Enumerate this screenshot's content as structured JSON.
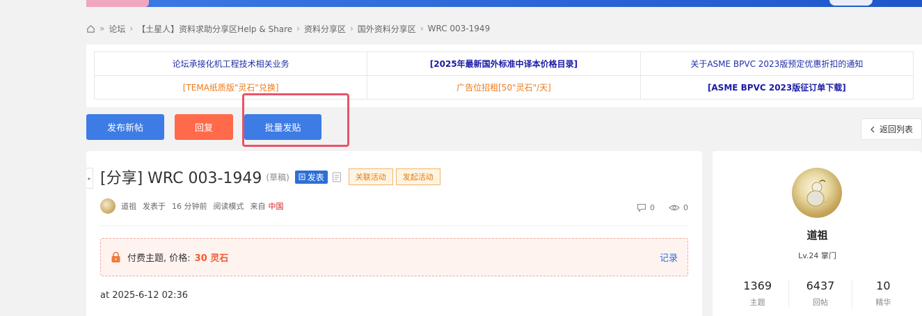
{
  "breadcrumb": {
    "items": [
      "论坛",
      "【土星人】资料求助分享区Help & Share",
      "资料分享区",
      "国外资料分享区",
      "WRC 003-1949"
    ]
  },
  "links": {
    "row1": [
      "论坛承接化机工程技术相关业务",
      "[2025年最新国外标准中译本价格目录]",
      "关于ASME BPVC 2023版预定优惠折扣的通知"
    ],
    "row2": [
      "[TEMA纸质版\"灵石\"兑换]",
      "广告位招租[50\"灵石\"/天]",
      "[ASME BPVC 2023版征订单下载]"
    ]
  },
  "actions": {
    "new_post": "发布新帖",
    "reply": "回复",
    "batch_post": "批量发贴",
    "back_to_list": "返回列表"
  },
  "thread": {
    "title": "[分享] WRC 003-1949",
    "draft_label": "(草稿)",
    "publish_label": "发表",
    "tag_related": "关联活动",
    "tag_launch": "发起活动",
    "author": "道祖",
    "posted_prefix": "发表于",
    "posted_time": "16 分钟前",
    "read_mode": "阅读模式",
    "from_prefix": "来自",
    "from_region": "中国",
    "reply_count": "0",
    "view_count": "0",
    "paid_label": "付费主题, 价格:",
    "price": "30 灵石",
    "record_label": "记录",
    "post_time": "at 2025-6-12 02:36"
  },
  "profile": {
    "name": "道祖",
    "level": "Lv.24 掌门",
    "stats": [
      {
        "value": "1369",
        "label": "主题"
      },
      {
        "value": "6437",
        "label": "回帖"
      },
      {
        "value": "10",
        "label": "精华"
      }
    ]
  },
  "colors": {
    "primary": "#3d7be5",
    "reply": "#ff6a4a",
    "highlight": "#e8536a",
    "price": "#f05a2e"
  }
}
